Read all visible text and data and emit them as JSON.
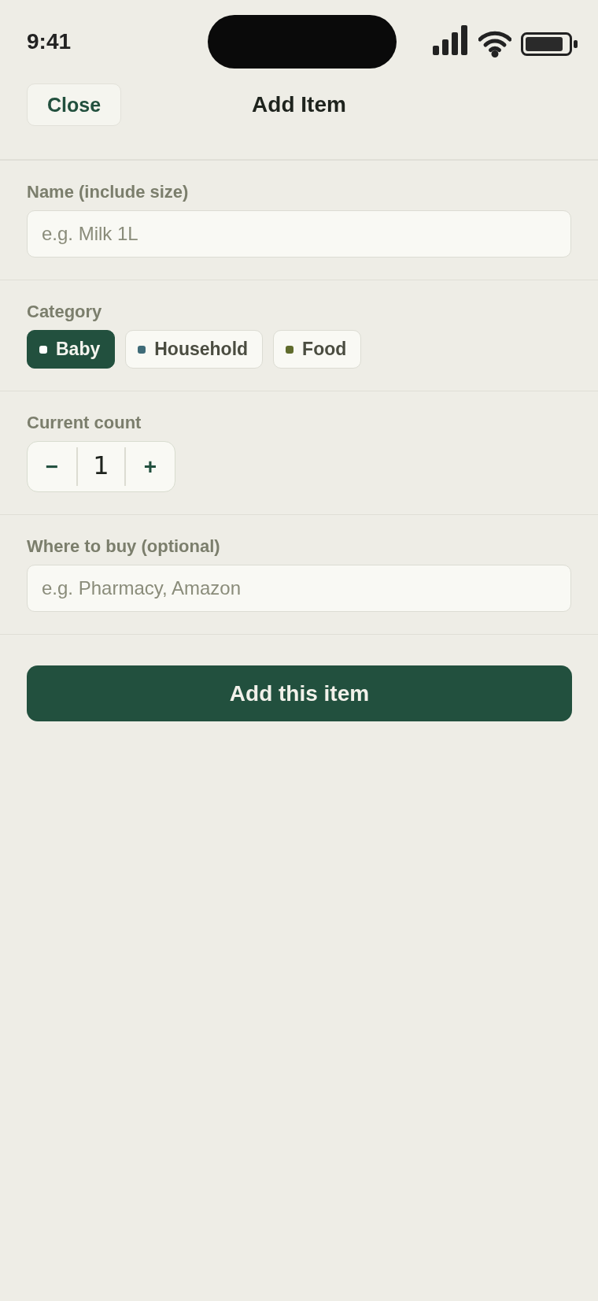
{
  "status_bar": {
    "time": "9:41"
  },
  "nav": {
    "close": "Close",
    "title": "Add Item"
  },
  "name_field": {
    "label": "Name (include size)",
    "placeholder": "e.g. Milk 1L"
  },
  "category": {
    "label": "Category",
    "options": [
      {
        "label": "Baby",
        "color": "#ffffff",
        "selected": true
      },
      {
        "label": "Household",
        "color": "#3f6b78",
        "selected": false
      },
      {
        "label": "Food",
        "color": "#5f6b2c",
        "selected": false
      }
    ]
  },
  "count": {
    "label": "Current count",
    "decrement": "−",
    "value": "1",
    "increment": "+"
  },
  "where_field": {
    "label": "Where to buy (optional)",
    "placeholder": "e.g. Pharmacy, Amazon"
  },
  "submit": "Add this item"
}
